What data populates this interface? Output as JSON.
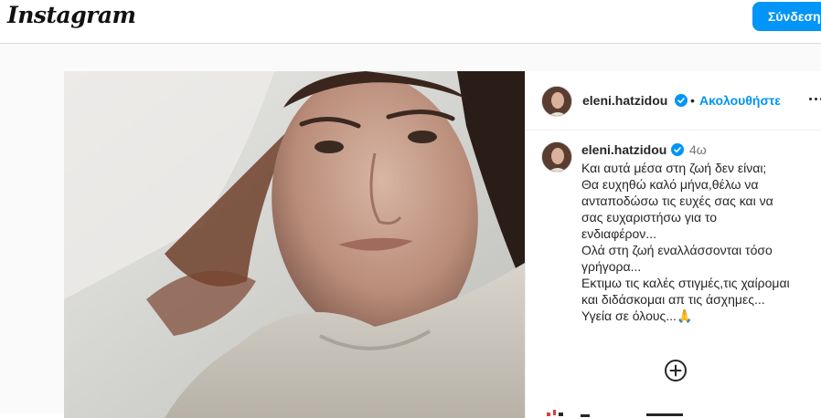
{
  "topbar": {
    "logo_text": "Instagram",
    "login_label": "Σύνδεση"
  },
  "post": {
    "username": "eleni.hatzidou",
    "follow_label": "Ακολουθήστε",
    "separator": "•",
    "caption_username": "eleni.hatzidou",
    "time_ago": "4ω",
    "caption_lines": [
      "Και αυτά μέσα στη ζωή δεν είναι;",
      "Θα ευχηθώ καλό μήνα,θέλω να",
      "ανταποδώσω τις ευχές σας και να",
      "σας ευχαριστήσω για το",
      "ενδιαφέρον...",
      "Ολά στη ζωή εναλλάσσονται τόσο",
      "γρήγορα...",
      "Εκτιμω τις καλές στιγμές,τις χαίρομαι",
      "και διδάσκομαι απ τις άσχημες...",
      "Υγεία σε όλους...🙏"
    ]
  },
  "colors": {
    "accent": "#0095f6",
    "verified": "#0095f6",
    "border": "#dbdbdb",
    "muted_text": "#737373"
  },
  "icons": {
    "more": "more-options-icon",
    "verified": "verified-badge-icon",
    "add": "add-circle-icon"
  }
}
